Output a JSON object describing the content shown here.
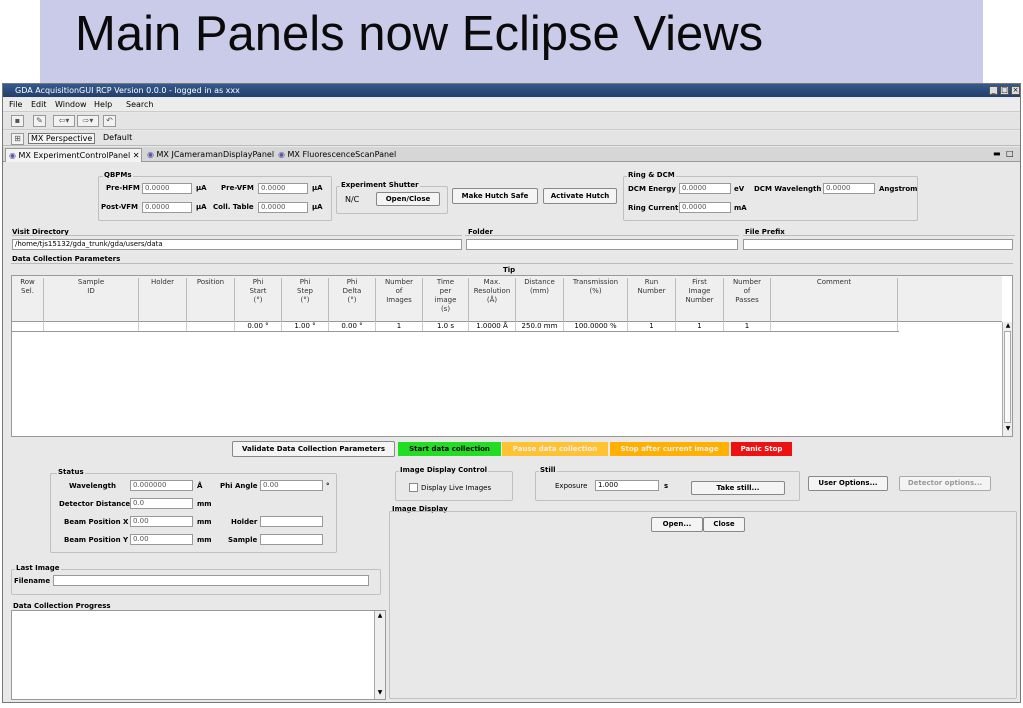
{
  "slide": {
    "title": "Main Panels now Eclipse Views"
  },
  "window": {
    "title": "GDA AcquisitionGUI RCP Version 0.0.0 - logged in as xxx"
  },
  "menu": [
    "File",
    "Edit",
    "Window",
    "Help",
    "Search"
  ],
  "perspectives": {
    "active": "MX Perspective",
    "other": "Default"
  },
  "tabs": [
    "MX ExperimentControlPanel",
    "MX JCameramanDisplayPanel",
    "MX FluorescenceScanPanel"
  ],
  "qbpms": {
    "group": "QBPMs",
    "pre_hfm_label": "Pre-HFM",
    "pre_hfm_value": "0.0000",
    "pre_hfm_unit": "µA",
    "pre_vfm_label": "Pre-VFM",
    "pre_vfm_value": "0.0000",
    "pre_vfm_unit": "µA",
    "post_vfm_label": "Post-VFM",
    "post_vfm_value": "0.0000",
    "post_vfm_unit": "µA",
    "coll_table_label": "Coll. Table",
    "coll_table_value": "0.0000",
    "coll_table_unit": "µA"
  },
  "shutter": {
    "group": "Experiment Shutter",
    "state": "N/C",
    "button": "Open/Close"
  },
  "hutch": {
    "safe": "Make Hutch Safe",
    "activate": "Activate Hutch"
  },
  "ring": {
    "group": "Ring & DCM",
    "energy_label": "DCM Energy",
    "energy_value": "0.0000",
    "energy_unit": "eV",
    "wavelength_label": "DCM Wavelength",
    "wavelength_value": "0.0000",
    "wavelength_unit": "Angstrom",
    "current_label": "Ring Current",
    "current_value": "0.0000",
    "current_unit": "mA"
  },
  "visit": {
    "label": "Visit Directory",
    "value": "/home/tjs15132/gda_trunk/gda/users/data"
  },
  "folder": {
    "label": "Folder",
    "value": ""
  },
  "prefix": {
    "label": "File Prefix",
    "value": ""
  },
  "dcp": {
    "label": "Data Collection Parameters",
    "tip": "Tip",
    "headers": [
      "Row\nSel.",
      "Sample\nID",
      "Holder",
      "Position",
      "Phi\nStart\n(°)",
      "Phi\nStep\n(°)",
      "Phi\nDelta\n(°)",
      "Number\nof\nImages",
      "Time\nper\nimage\n(s)",
      "Max.\nResolution\n(Å)",
      "Distance\n(mm)",
      "Transmission\n(%)",
      "Run\nNumber",
      "First\nImage\nNumber",
      "Number\nof\nPasses",
      "Comment"
    ],
    "row": [
      "",
      "",
      "",
      "",
      "0.00 °",
      "1.00 °",
      "0.00 °",
      "1",
      "1.0 s",
      "1.0000 Å",
      "250.0 mm",
      "100.0000 %",
      "1",
      "1",
      "1",
      ""
    ]
  },
  "actions": {
    "validate": "Validate Data Collection Parameters",
    "start": "Start data collection",
    "pause": "Pause data collection",
    "stop": "Stop after current image",
    "panic": "Panic Stop",
    "start_color": "#22dd22",
    "pause_color": "#ffc233",
    "stop_color": "#ffb000",
    "panic_color": "#ee1111"
  },
  "status": {
    "group": "Status",
    "wavelength_label": "Wavelength",
    "wavelength_value": "0.000000",
    "wavelength_unit": "Å",
    "phi_label": "Phi Angle",
    "phi_value": "0.00",
    "phi_unit": "°",
    "distance_label": "Detector Distance",
    "distance_value": "0.0",
    "distance_unit": "mm",
    "beamx_label": "Beam Position X",
    "beamx_value": "0.00",
    "beamx_unit": "mm",
    "holder_label": "Holder",
    "holder_value": "",
    "beamy_label": "Beam Position Y",
    "beamy_value": "0.00",
    "beamy_unit": "mm",
    "sample_label": "Sample",
    "sample_value": ""
  },
  "last_image": {
    "group": "Last Image",
    "filename_label": "Filename",
    "filename_value": ""
  },
  "progress": {
    "group": "Data Collection Progress"
  },
  "image_display_control": {
    "group": "Image Display Control",
    "live_label": "Display Live Images"
  },
  "still": {
    "group": "Still",
    "exposure_label": "Exposure",
    "exposure_value": "1.000",
    "exposure_unit": "s",
    "take_still": "Take still..."
  },
  "options": {
    "user": "User Options...",
    "detector": "Detector options..."
  },
  "image_display": {
    "group": "Image Display",
    "open": "Open...",
    "close": "Close"
  }
}
